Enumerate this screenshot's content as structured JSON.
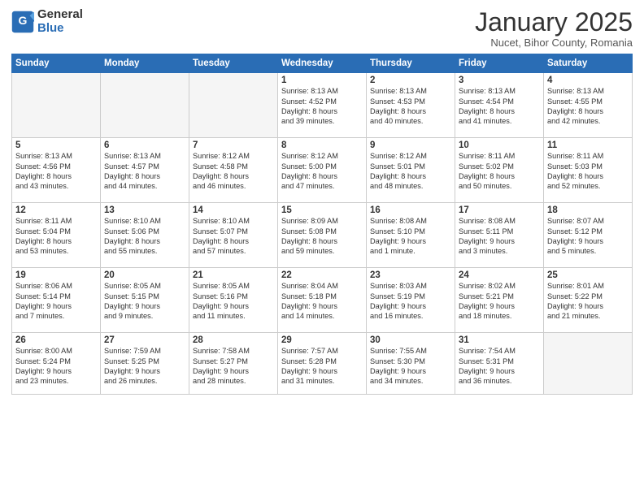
{
  "logo": {
    "general": "General",
    "blue": "Blue"
  },
  "title": "January 2025",
  "location": "Nucet, Bihor County, Romania",
  "weekdays": [
    "Sunday",
    "Monday",
    "Tuesday",
    "Wednesday",
    "Thursday",
    "Friday",
    "Saturday"
  ],
  "weeks": [
    [
      {
        "day": "",
        "info": ""
      },
      {
        "day": "",
        "info": ""
      },
      {
        "day": "",
        "info": ""
      },
      {
        "day": "1",
        "info": "Sunrise: 8:13 AM\nSunset: 4:52 PM\nDaylight: 8 hours\nand 39 minutes."
      },
      {
        "day": "2",
        "info": "Sunrise: 8:13 AM\nSunset: 4:53 PM\nDaylight: 8 hours\nand 40 minutes."
      },
      {
        "day": "3",
        "info": "Sunrise: 8:13 AM\nSunset: 4:54 PM\nDaylight: 8 hours\nand 41 minutes."
      },
      {
        "day": "4",
        "info": "Sunrise: 8:13 AM\nSunset: 4:55 PM\nDaylight: 8 hours\nand 42 minutes."
      }
    ],
    [
      {
        "day": "5",
        "info": "Sunrise: 8:13 AM\nSunset: 4:56 PM\nDaylight: 8 hours\nand 43 minutes."
      },
      {
        "day": "6",
        "info": "Sunrise: 8:13 AM\nSunset: 4:57 PM\nDaylight: 8 hours\nand 44 minutes."
      },
      {
        "day": "7",
        "info": "Sunrise: 8:12 AM\nSunset: 4:58 PM\nDaylight: 8 hours\nand 46 minutes."
      },
      {
        "day": "8",
        "info": "Sunrise: 8:12 AM\nSunset: 5:00 PM\nDaylight: 8 hours\nand 47 minutes."
      },
      {
        "day": "9",
        "info": "Sunrise: 8:12 AM\nSunset: 5:01 PM\nDaylight: 8 hours\nand 48 minutes."
      },
      {
        "day": "10",
        "info": "Sunrise: 8:11 AM\nSunset: 5:02 PM\nDaylight: 8 hours\nand 50 minutes."
      },
      {
        "day": "11",
        "info": "Sunrise: 8:11 AM\nSunset: 5:03 PM\nDaylight: 8 hours\nand 52 minutes."
      }
    ],
    [
      {
        "day": "12",
        "info": "Sunrise: 8:11 AM\nSunset: 5:04 PM\nDaylight: 8 hours\nand 53 minutes."
      },
      {
        "day": "13",
        "info": "Sunrise: 8:10 AM\nSunset: 5:06 PM\nDaylight: 8 hours\nand 55 minutes."
      },
      {
        "day": "14",
        "info": "Sunrise: 8:10 AM\nSunset: 5:07 PM\nDaylight: 8 hours\nand 57 minutes."
      },
      {
        "day": "15",
        "info": "Sunrise: 8:09 AM\nSunset: 5:08 PM\nDaylight: 8 hours\nand 59 minutes."
      },
      {
        "day": "16",
        "info": "Sunrise: 8:08 AM\nSunset: 5:10 PM\nDaylight: 9 hours\nand 1 minute."
      },
      {
        "day": "17",
        "info": "Sunrise: 8:08 AM\nSunset: 5:11 PM\nDaylight: 9 hours\nand 3 minutes."
      },
      {
        "day": "18",
        "info": "Sunrise: 8:07 AM\nSunset: 5:12 PM\nDaylight: 9 hours\nand 5 minutes."
      }
    ],
    [
      {
        "day": "19",
        "info": "Sunrise: 8:06 AM\nSunset: 5:14 PM\nDaylight: 9 hours\nand 7 minutes."
      },
      {
        "day": "20",
        "info": "Sunrise: 8:05 AM\nSunset: 5:15 PM\nDaylight: 9 hours\nand 9 minutes."
      },
      {
        "day": "21",
        "info": "Sunrise: 8:05 AM\nSunset: 5:16 PM\nDaylight: 9 hours\nand 11 minutes."
      },
      {
        "day": "22",
        "info": "Sunrise: 8:04 AM\nSunset: 5:18 PM\nDaylight: 9 hours\nand 14 minutes."
      },
      {
        "day": "23",
        "info": "Sunrise: 8:03 AM\nSunset: 5:19 PM\nDaylight: 9 hours\nand 16 minutes."
      },
      {
        "day": "24",
        "info": "Sunrise: 8:02 AM\nSunset: 5:21 PM\nDaylight: 9 hours\nand 18 minutes."
      },
      {
        "day": "25",
        "info": "Sunrise: 8:01 AM\nSunset: 5:22 PM\nDaylight: 9 hours\nand 21 minutes."
      }
    ],
    [
      {
        "day": "26",
        "info": "Sunrise: 8:00 AM\nSunset: 5:24 PM\nDaylight: 9 hours\nand 23 minutes."
      },
      {
        "day": "27",
        "info": "Sunrise: 7:59 AM\nSunset: 5:25 PM\nDaylight: 9 hours\nand 26 minutes."
      },
      {
        "day": "28",
        "info": "Sunrise: 7:58 AM\nSunset: 5:27 PM\nDaylight: 9 hours\nand 28 minutes."
      },
      {
        "day": "29",
        "info": "Sunrise: 7:57 AM\nSunset: 5:28 PM\nDaylight: 9 hours\nand 31 minutes."
      },
      {
        "day": "30",
        "info": "Sunrise: 7:55 AM\nSunset: 5:30 PM\nDaylight: 9 hours\nand 34 minutes."
      },
      {
        "day": "31",
        "info": "Sunrise: 7:54 AM\nSunset: 5:31 PM\nDaylight: 9 hours\nand 36 minutes."
      },
      {
        "day": "",
        "info": ""
      }
    ]
  ]
}
